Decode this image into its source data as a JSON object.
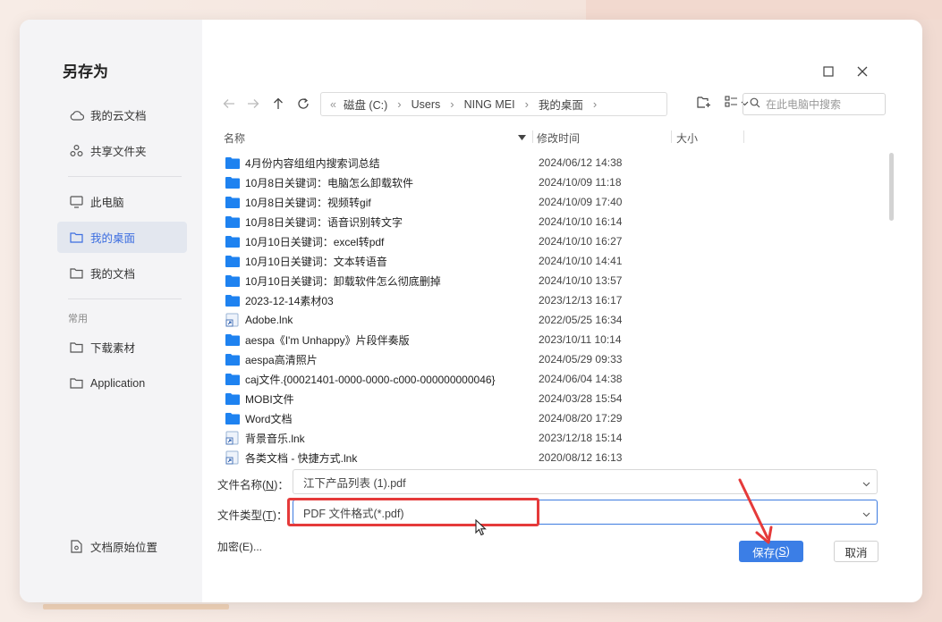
{
  "dialog": {
    "title": "另存为"
  },
  "sidebar": {
    "items": [
      {
        "label": "我的云文档",
        "icon": "cloud-icon"
      },
      {
        "label": "共享文件夹",
        "icon": "share-folder-icon"
      },
      {
        "label": "此电脑",
        "icon": "computer-icon"
      },
      {
        "label": "我的桌面",
        "icon": "folder-icon",
        "active": true
      },
      {
        "label": "我的文档",
        "icon": "folder-icon"
      }
    ],
    "section_label": "常用",
    "common_items": [
      {
        "label": "下载素材",
        "icon": "folder-icon"
      },
      {
        "label": "Application",
        "icon": "folder-icon"
      }
    ],
    "bottom_item": {
      "label": "文档原始位置",
      "icon": "document-location-icon"
    }
  },
  "breadcrumb": [
    "磁盘 (C:)",
    "Users",
    "NING MEI",
    "我的桌面"
  ],
  "search": {
    "placeholder": "在此电脑中搜索"
  },
  "columns": {
    "name": "名称",
    "modified": "修改时间",
    "size": "大小"
  },
  "files": [
    {
      "name": "4月份内容组组内搜索词总结",
      "date": "2024/06/12 14:38",
      "type": "folder"
    },
    {
      "name": "10月8日关键词：电脑怎么卸载软件",
      "date": "2024/10/09 11:18",
      "type": "folder"
    },
    {
      "name": "10月8日关键词：视频转gif",
      "date": "2024/10/09 17:40",
      "type": "folder"
    },
    {
      "name": "10月8日关键词：语音识别转文字",
      "date": "2024/10/10 16:14",
      "type": "folder"
    },
    {
      "name": "10月10日关键词：excel转pdf",
      "date": "2024/10/10 16:27",
      "type": "folder"
    },
    {
      "name": "10月10日关键词：文本转语音",
      "date": "2024/10/10 14:41",
      "type": "folder"
    },
    {
      "name": "10月10日关键词：卸载软件怎么彻底删掉",
      "date": "2024/10/10 13:57",
      "type": "folder"
    },
    {
      "name": "2023-12-14素材03",
      "date": "2023/12/13 16:17",
      "type": "folder"
    },
    {
      "name": "Adobe.lnk",
      "date": "2022/05/25 16:34",
      "type": "shortcut"
    },
    {
      "name": "aespa《I'm Unhappy》片段伴奏版",
      "date": "2023/10/11 10:14",
      "type": "folder"
    },
    {
      "name": "aespa高清照片",
      "date": "2024/05/29 09:33",
      "type": "folder"
    },
    {
      "name": "caj文件.{00021401-0000-0000-c000-000000000046}",
      "date": "2024/06/04 14:38",
      "type": "folder"
    },
    {
      "name": "MOBI文件",
      "date": "2024/03/28 15:54",
      "type": "folder"
    },
    {
      "name": "Word文档",
      "date": "2024/08/20 17:29",
      "type": "folder"
    },
    {
      "name": "背景音乐.lnk",
      "date": "2023/12/18 15:14",
      "type": "shortcut"
    },
    {
      "name": "各类文档 - 快捷方式.lnk",
      "date": "2020/08/12 16:13",
      "type": "shortcut"
    }
  ],
  "form": {
    "filename_label_pre": "文件名称(",
    "filename_label_key": "N",
    "filename_label_post": ")：",
    "filename_value": "江下产品列表 (1).pdf",
    "filetype_label_pre": "文件类型(",
    "filetype_label_key": "T",
    "filetype_label_post": ")：",
    "filetype_value": "PDF 文件格式(*.pdf)",
    "encrypt_label": "加密(E)..."
  },
  "buttons": {
    "save_pre": "保存(",
    "save_key": "S",
    "save_post": ")",
    "cancel": "取消"
  },
  "colors": {
    "accent": "#3b7ee6",
    "folder": "#1e82f0",
    "highlight": "#e53a3a"
  }
}
